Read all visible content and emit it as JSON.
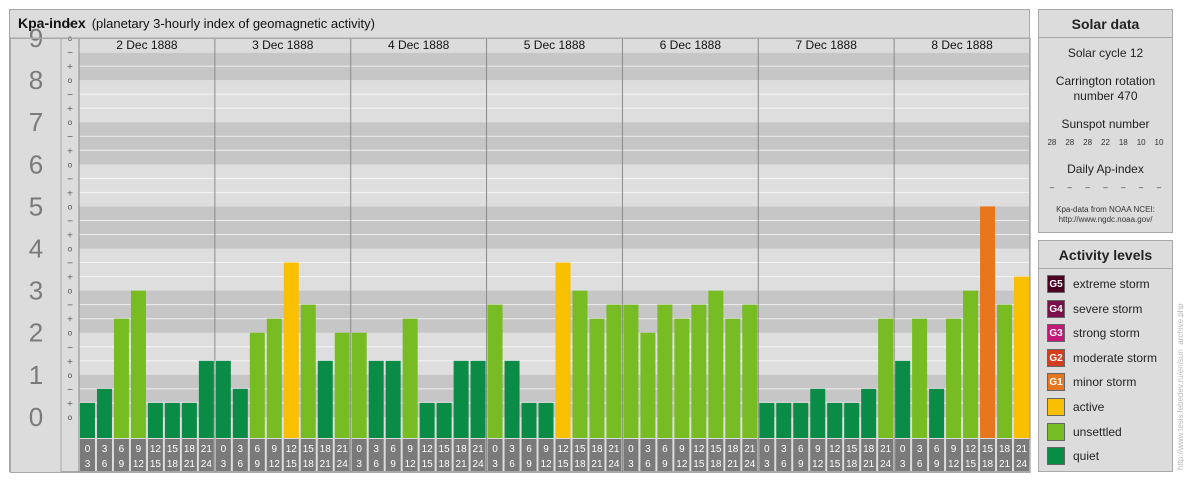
{
  "title": {
    "main": "Kpa-index",
    "sub": "(planetary 3-hourly index of geomagnetic activity)"
  },
  "colors": {
    "quiet": "#0a8c46",
    "unsettled": "#76bc22",
    "active": "#f8c000",
    "minor": "#e8761c",
    "moderate": "#d43d1e",
    "strong": "#c2187a",
    "severe": "#7a1048",
    "extreme": "#4a0024"
  },
  "chart_data": {
    "type": "bar",
    "title": "Kpa-index",
    "ylim": [
      0,
      9
    ],
    "y_ticks": [
      "0",
      "1",
      "2",
      "3",
      "4",
      "5",
      "6",
      "7",
      "8",
      "9"
    ],
    "minor_labels": [
      "−",
      "o",
      "+"
    ],
    "days": [
      "2 Dec 1888",
      "3 Dec 1888",
      "4 Dec 1888",
      "5 Dec 1888",
      "6 Dec 1888",
      "7 Dec 1888",
      "8 Dec 1888"
    ],
    "hour_labels": [
      [
        "0",
        "3"
      ],
      [
        "3",
        "6"
      ],
      [
        "6",
        "9"
      ],
      [
        "9",
        "12"
      ],
      [
        "12",
        "15"
      ],
      [
        "15",
        "18"
      ],
      [
        "18",
        "21"
      ],
      [
        "21",
        "24"
      ]
    ],
    "values": [
      [
        0.333,
        0.667,
        2.333,
        3.0,
        0.333,
        0.333,
        0.333,
        1.333
      ],
      [
        1.333,
        0.667,
        2.0,
        2.333,
        3.667,
        2.667,
        1.333,
        2.0
      ],
      [
        2.0,
        1.333,
        1.333,
        2.333,
        0.333,
        0.333,
        1.333,
        1.333
      ],
      [
        2.667,
        1.333,
        0.333,
        0.333,
        3.667,
        3.0,
        2.333,
        2.667
      ],
      [
        2.667,
        2.0,
        2.667,
        2.333,
        2.667,
        3.0,
        2.333,
        2.667
      ],
      [
        0.333,
        0.333,
        0.333,
        0.667,
        0.333,
        0.333,
        0.667,
        2.333
      ],
      [
        1.333,
        2.333,
        0.667,
        2.333,
        3.0,
        5.0,
        2.667,
        3.333
      ]
    ]
  },
  "solar": {
    "title": "Solar data",
    "cycle": "Solar cycle 12",
    "carrington": "Carrington rotation number 470",
    "sunspot_title": "Sunspot number",
    "sunspots": [
      "28",
      "28",
      "28",
      "22",
      "18",
      "10",
      "10"
    ],
    "ap_title": "Daily Ap-index",
    "ap": [
      "–",
      "–",
      "–",
      "–",
      "–",
      "–",
      "–"
    ],
    "source_line1": "Kpa-data from NOAA NCEI:",
    "source_line2": "http://www.ngdc.noaa.gov/"
  },
  "activity": {
    "title": "Activity levels",
    "items": [
      {
        "code": "G5",
        "label": "extreme storm",
        "color": "#4a0024"
      },
      {
        "code": "G4",
        "label": "severe storm",
        "color": "#7a1048"
      },
      {
        "code": "G3",
        "label": "strong storm",
        "color": "#c2187a"
      },
      {
        "code": "G2",
        "label": "moderate storm",
        "color": "#d43d1e"
      },
      {
        "code": "G1",
        "label": "minor storm",
        "color": "#e8761c"
      },
      {
        "code": "",
        "label": "active",
        "color": "#f8c000"
      },
      {
        "code": "",
        "label": "unsettled",
        "color": "#76bc22"
      },
      {
        "code": "",
        "label": "quiet",
        "color": "#0a8c46"
      }
    ]
  },
  "watermark": "http://www.tesis.lebedev.ru/en/sun_archive.php"
}
